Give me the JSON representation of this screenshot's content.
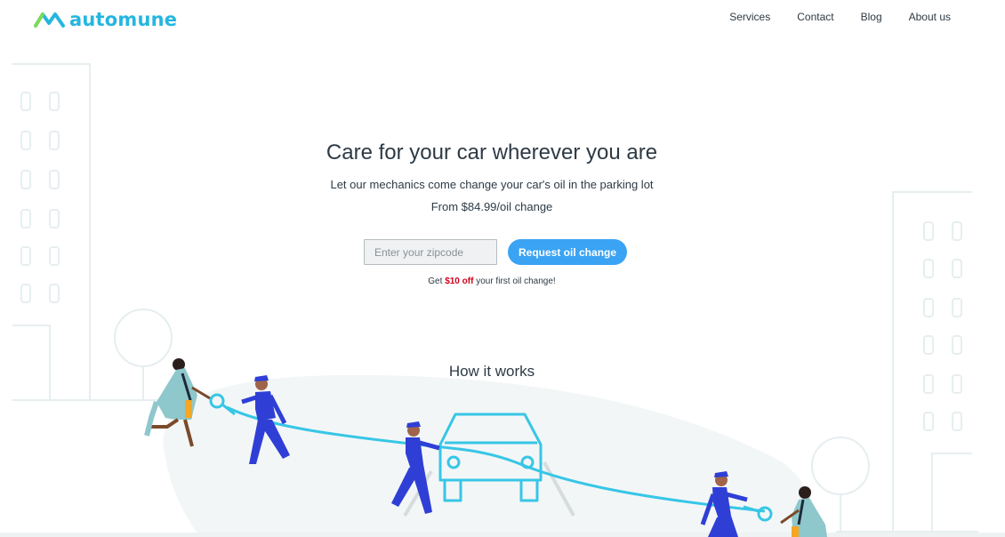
{
  "brand": {
    "name": "automune"
  },
  "nav": {
    "items": [
      {
        "label": "Services"
      },
      {
        "label": "Contact"
      },
      {
        "label": "Blog"
      },
      {
        "label": "About us"
      }
    ]
  },
  "hero": {
    "title": "Care for your car wherever you are",
    "subtitle": "Let our mechanics come change your car's oil in the parking lot",
    "price": "From $84.99/oil change"
  },
  "form": {
    "zip_placeholder": "Enter your zipcode",
    "zip_value": "",
    "button_label": "Request oil change"
  },
  "promo": {
    "prefix": "Get",
    "highlight": "$10 off",
    "suffix": "your first oil change!"
  },
  "how": {
    "title": "How it works"
  },
  "colors": {
    "brand": "#25b6e0",
    "button": "#3ba3f3",
    "promo_highlight": "#d0021b",
    "text": "#2d3a45",
    "uniform": "#2f3fd6",
    "coat": "#8ec7cc",
    "cable": "#37c6e6"
  },
  "icons": [
    "logo-mark-icon",
    "car-icon",
    "key-icon",
    "building-icon",
    "tree-icon"
  ]
}
